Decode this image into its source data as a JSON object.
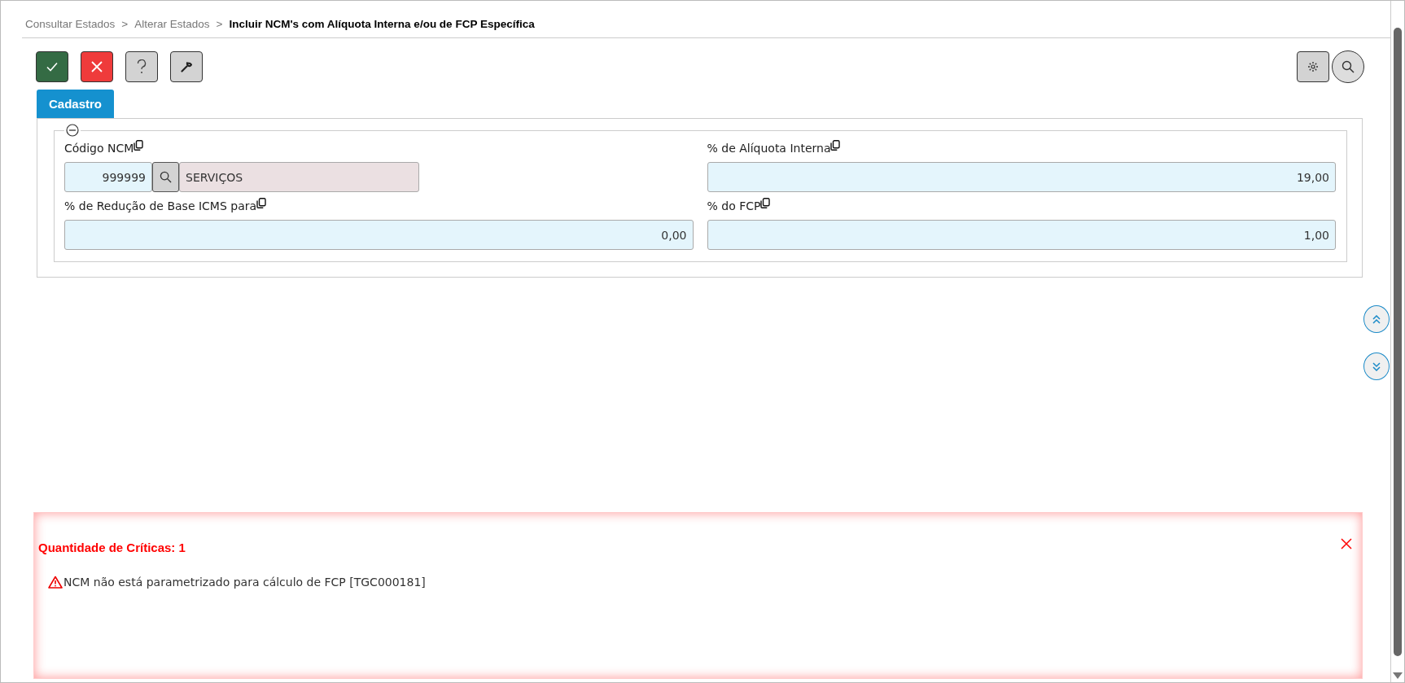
{
  "breadcrumb": [
    {
      "label": "Consultar Estados",
      "current": false
    },
    {
      "label": "Alterar Estados",
      "current": false
    },
    {
      "label": "Incluir NCM's com Alíquota Interna e/ou de FCP Específica",
      "current": true
    }
  ],
  "breadcrumb_separator": ">",
  "tabs": [
    {
      "label": "Cadastro",
      "selected": true
    }
  ],
  "fields": [
    {
      "kind": "lookup",
      "label": "Código NCM",
      "value": "999999",
      "description": "SERVIÇOS"
    },
    {
      "kind": "number",
      "label": "% de Alíquota Interna",
      "value": "19,00"
    },
    {
      "kind": "number",
      "label": "% de Redução de Base ICMS para",
      "value": "0,00"
    },
    {
      "kind": "number",
      "label": "% do FCP",
      "value": "1,00"
    }
  ],
  "errors": {
    "title": "Quantidade de Críticas: 1",
    "messages": [
      "NCM não está parametrizado para cálculo de FCP [TGC000181]"
    ]
  }
}
